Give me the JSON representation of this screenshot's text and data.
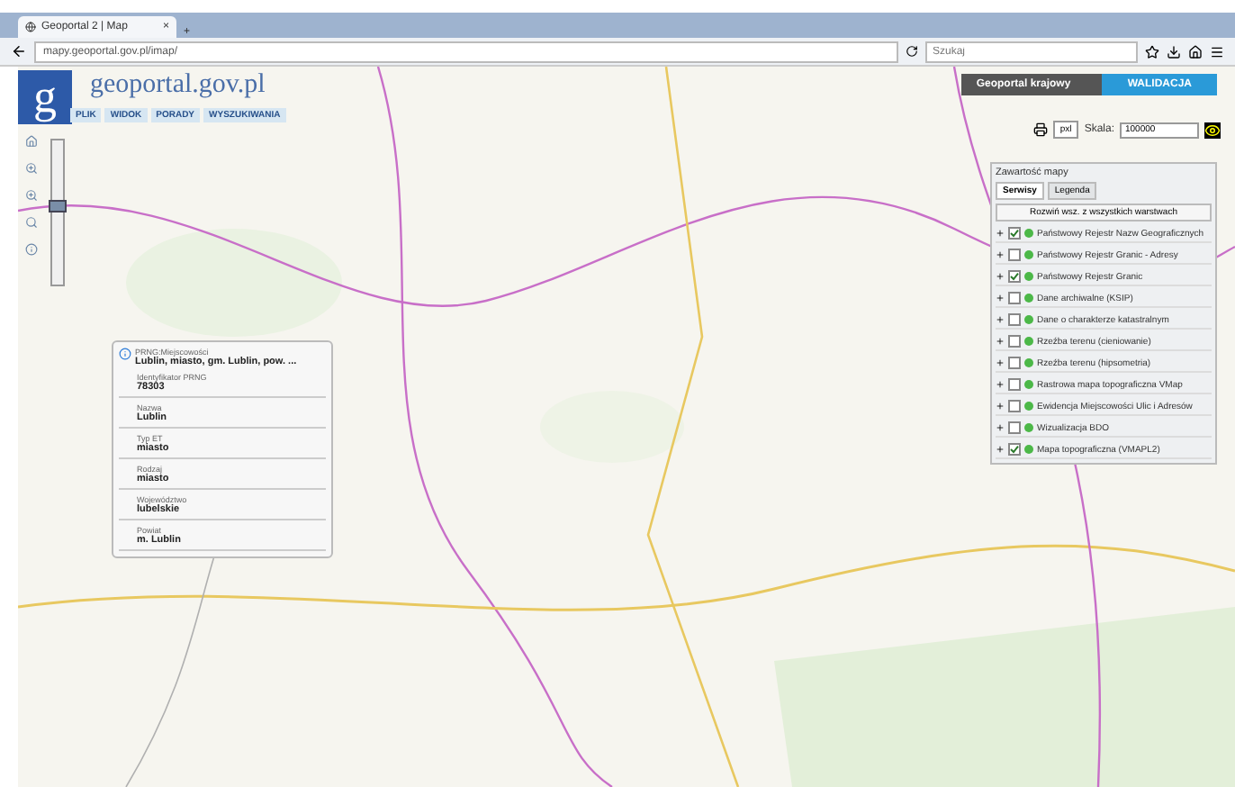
{
  "browser": {
    "tab_title": "Geoportal 2 | Map",
    "tab_close": "×",
    "new_tab": "+",
    "url": "mapy.geoportal.gov.pl/imap/",
    "search_placeholder": "Szukaj"
  },
  "header": {
    "logo_letter": "g",
    "site_name": "geoportal.gov.pl",
    "menu": [
      {
        "label": "PLIK",
        "selected": false
      },
      {
        "label": "WIDOK",
        "selected": false
      },
      {
        "label": "PORADY",
        "selected": false
      },
      {
        "label": "WYSZUKIWANIA",
        "selected": false
      }
    ]
  },
  "zoom": {
    "level": 0.55
  },
  "top_right": {
    "service": "Geoportal krajowy",
    "action": "WALIDACJA",
    "unit": "pxl",
    "scale_label": "Skala:",
    "scale_value": "100000"
  },
  "layers_panel": {
    "title": "Zawartość mapy",
    "tabs": [
      {
        "label": "Serwisy",
        "selected": true
      },
      {
        "label": "Legenda",
        "selected": false
      }
    ],
    "expand_button": "Rozwiń wsz. z wszystkich warstwach",
    "layers": [
      {
        "name": "Państwowy Rejestr Nazw Geograficznych",
        "checked": true
      },
      {
        "name": "Państwowy Rejestr Granic - Adresy",
        "checked": false
      },
      {
        "name": "Państwowy Rejestr Granic",
        "checked": true
      },
      {
        "name": "Dane archiwalne (KSIP)",
        "checked": false
      },
      {
        "name": "Dane o charakterze katastralnym",
        "checked": false
      },
      {
        "name": "Rzeźba terenu (cieniowanie)",
        "checked": false
      },
      {
        "name": "Rzeźba terenu (hipsometria)",
        "checked": false
      },
      {
        "name": "Rastrowa mapa topograficzna VMap",
        "checked": false
      },
      {
        "name": "Ewidencja Miejscowości Ulic i Adresów",
        "checked": false
      },
      {
        "name": "Wizualizacja BDO",
        "checked": false
      },
      {
        "name": "Mapa topograficzna (VMAPL2)",
        "checked": true
      }
    ]
  },
  "info_popup": {
    "layer": "PRNG:Miejscowości",
    "title": "Lublin, miasto, gm. Lublin, pow. ...",
    "fields": [
      {
        "label": "Identyfikator PRNG",
        "value": "78303"
      },
      {
        "label": "Nazwa",
        "value": "Lublin"
      },
      {
        "label": "Typ ET",
        "value": "miasto"
      },
      {
        "label": "Rodzaj",
        "value": "miasto"
      },
      {
        "label": "Województwo",
        "value": "lubelskie"
      },
      {
        "label": "Powiat",
        "value": "m. Lublin"
      }
    ]
  }
}
